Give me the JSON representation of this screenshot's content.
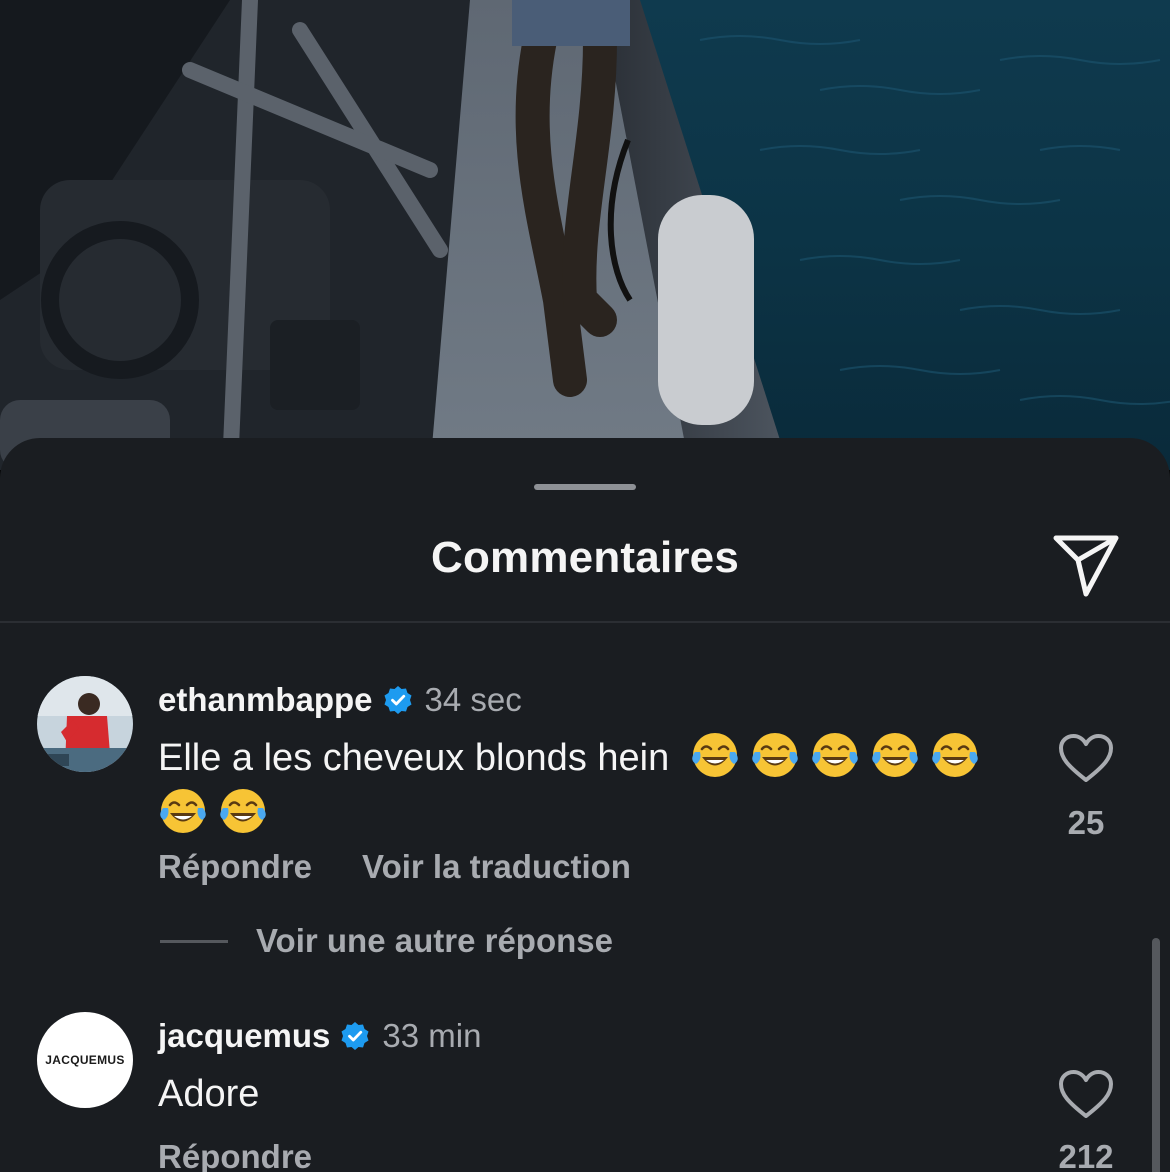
{
  "sheet": {
    "title": "Commentaires",
    "share_icon": "send-icon"
  },
  "comments": [
    {
      "username": "ethanmbappe",
      "verified": true,
      "time": "34 sec",
      "text": "Elle a les cheveux blonds hein",
      "emojis": [
        "😂",
        "😂",
        "😂",
        "😂",
        "😂",
        "😂",
        "😂"
      ],
      "likes": "25",
      "reply_label": "Répondre",
      "translate_label": "Voir la traduction",
      "more_replies_label": "Voir une autre réponse"
    },
    {
      "username": "jacquemus",
      "verified": true,
      "time": "33 min",
      "text": "Adore",
      "likes": "212",
      "reply_label": "Répondre",
      "avatar_logo": "JACQUEMUS"
    }
  ],
  "colors": {
    "sheet_bg": "#1a1d21",
    "primary_text": "#f5f5f5",
    "secondary_text": "#a8abb0",
    "verified_blue": "#1d9bf0"
  }
}
